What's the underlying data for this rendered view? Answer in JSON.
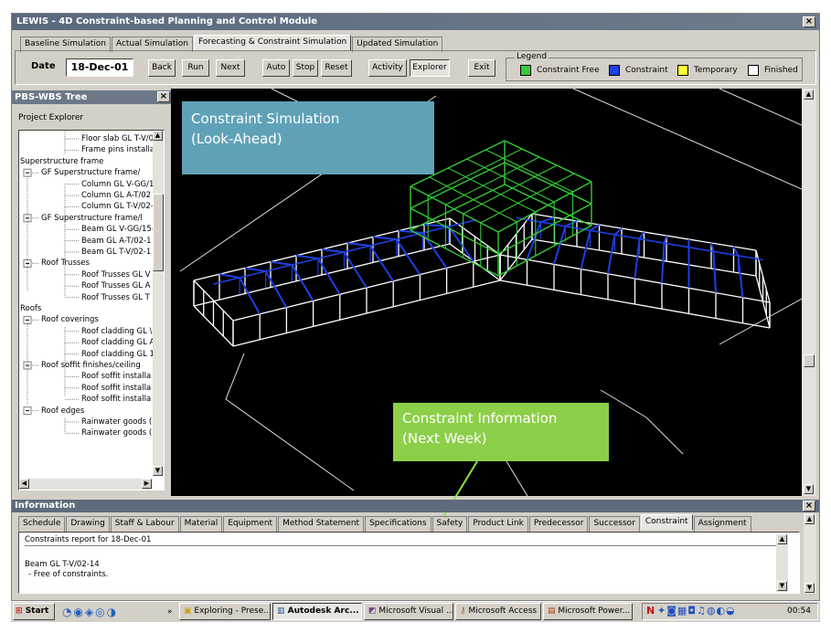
{
  "window": {
    "title": "LEWIS - 4D Constraint-based Planning and Control Module",
    "close": "×"
  },
  "mode_tabs": [
    "Baseline Simulation",
    "Actual Simulation",
    "Forecasting & Constraint Simulation",
    "Updated Simulation"
  ],
  "toolbar": {
    "date_label": "Date",
    "date_value": "18-Dec-01",
    "back": "Back",
    "run": "Run",
    "next": "Next",
    "auto": "Auto",
    "stop": "Stop",
    "reset": "Reset",
    "activity": "Activity",
    "explorer": "Explorer",
    "exit": "Exit"
  },
  "legend": {
    "title": "Legend",
    "items": [
      {
        "label": "Constraint Free",
        "color": "#33cc33"
      },
      {
        "label": "Constraint",
        "color": "#1f3fe0"
      },
      {
        "label": "Temporary",
        "color": "#ffff33"
      },
      {
        "label": "Finished",
        "color": "#ffffff"
      }
    ]
  },
  "pbs_panel": {
    "title": "PBS-WBS Tree",
    "close": "×",
    "header": "Project Explorer",
    "tree": [
      {
        "text": "Floor slab GL T-V/0"
      },
      {
        "text": "Frame pins installa"
      },
      {
        "text": "Superstructure frame"
      },
      {
        "text": "GF Superstructure frame/"
      },
      {
        "text": "Column GL V-GG/1"
      },
      {
        "text": "Column GL A-T/02"
      },
      {
        "text": "Column GL T-V/02-"
      },
      {
        "text": "GF Superstructure frame/l"
      },
      {
        "text": "Beam GL V-GG/15-"
      },
      {
        "text": "Beam GL A-T/02-1"
      },
      {
        "text": "Beam GL T-V/02-1"
      },
      {
        "text": "Roof Trusses"
      },
      {
        "text": "Roof Trusses GL V"
      },
      {
        "text": "Roof Trusses GL A"
      },
      {
        "text": "Roof Trusses GL T"
      },
      {
        "text": "Roofs"
      },
      {
        "text": "Roof coverings"
      },
      {
        "text": "Roof cladding GL \\"
      },
      {
        "text": "Roof cladding GL A"
      },
      {
        "text": "Roof cladding GL 1"
      },
      {
        "text": "Roof soffit finishes/ceiling"
      },
      {
        "text": "Roof soffit installa"
      },
      {
        "text": "Roof soffit installa"
      },
      {
        "text": "Roof soffit installa"
      },
      {
        "text": "Roof edges"
      },
      {
        "text": "Rainwater goods ("
      },
      {
        "text": "Rainwater goods ("
      }
    ]
  },
  "viewport": {
    "callout_top": [
      "Constraint Simulation",
      "(Look-Ahead)"
    ],
    "callout_bottom": [
      "Constraint Information",
      "(Next Week)"
    ]
  },
  "info_panel": {
    "title": "Information",
    "close": "×",
    "tabs": [
      "Schedule",
      "Drawing",
      "Staff & Labour",
      "Material",
      "Equipment",
      "Method Statement",
      "Specifications",
      "Safety",
      "Product Link",
      "Predecessor",
      "Successor",
      "Constraint",
      "Assignment"
    ],
    "active_tab": "Constraint",
    "report_header": "Constraints report for 18-Dec-01",
    "report_lines": [
      "Beam GL T-V/02-14",
      "- Free of constraints."
    ]
  },
  "taskbar": {
    "start": "Start",
    "tasks": [
      "Exploring - Prese...",
      "Autodesk Arc...",
      "Microsoft Visual ...",
      "Microsoft Access",
      "Microsoft Power..."
    ],
    "active_task": "Autodesk Arc...",
    "clock": "00:54"
  }
}
